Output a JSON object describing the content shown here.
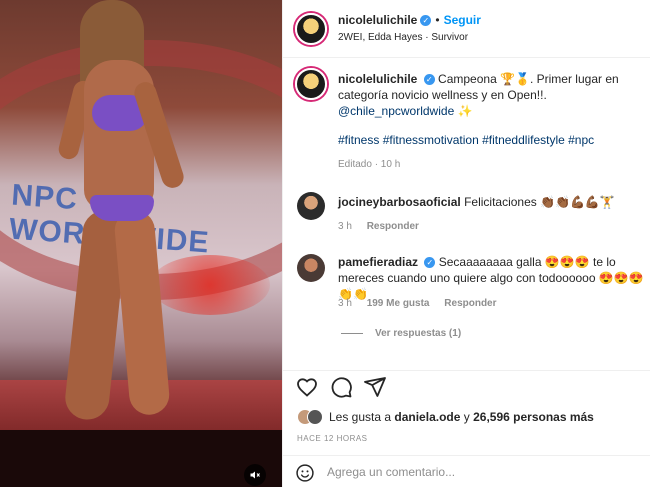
{
  "post": {
    "author": "nicolelulichile",
    "follow_label": "Seguir",
    "audio": "2WEI, Edda Hayes · Survivor",
    "caption_user": "nicolelulichile",
    "caption_text": "Campeona 🏆🥇. Primer lugar en categoría novicio wellness y en Open!!.",
    "caption_mention": "@chile_npcworldwide",
    "caption_emoji": "✨",
    "hashtags": "#fitness #fitnessmotivation #fitneddlifestyle #npc",
    "edited": "Editado · 10 h"
  },
  "comments": [
    {
      "user": "jocineybarbosaoficial",
      "text": "Felicitaciones 👏🏾👏🏾💪🏾💪🏾🏋",
      "time": "3 h",
      "reply_label": "Responder"
    },
    {
      "user": "pamefieradiaz",
      "text": "Secaaaaaaaa galla 😍😍😍 te lo mereces cuando uno quiere algo con todoooooo 😍😍😍👏👏",
      "time": "3 h",
      "likes": "199 Me gusta",
      "reply_label": "Responder",
      "view_replies": "Ver respuestas (1)"
    }
  ],
  "actions": {
    "like_icon": "heart-icon",
    "comment_icon": "comment-icon",
    "share_icon": "share-icon",
    "likes_prefix": "Les gusta a",
    "likes_user": "daniela.ode",
    "likes_connector": "y",
    "likes_count": "26,596 personas más",
    "time_ago": "HACE 12 HORAS"
  },
  "comment_box": {
    "placeholder": "Agrega un comentario..."
  },
  "media": {
    "banner_text": "NPC WORLDWIDE",
    "mute_icon": "muted-speaker-icon"
  }
}
